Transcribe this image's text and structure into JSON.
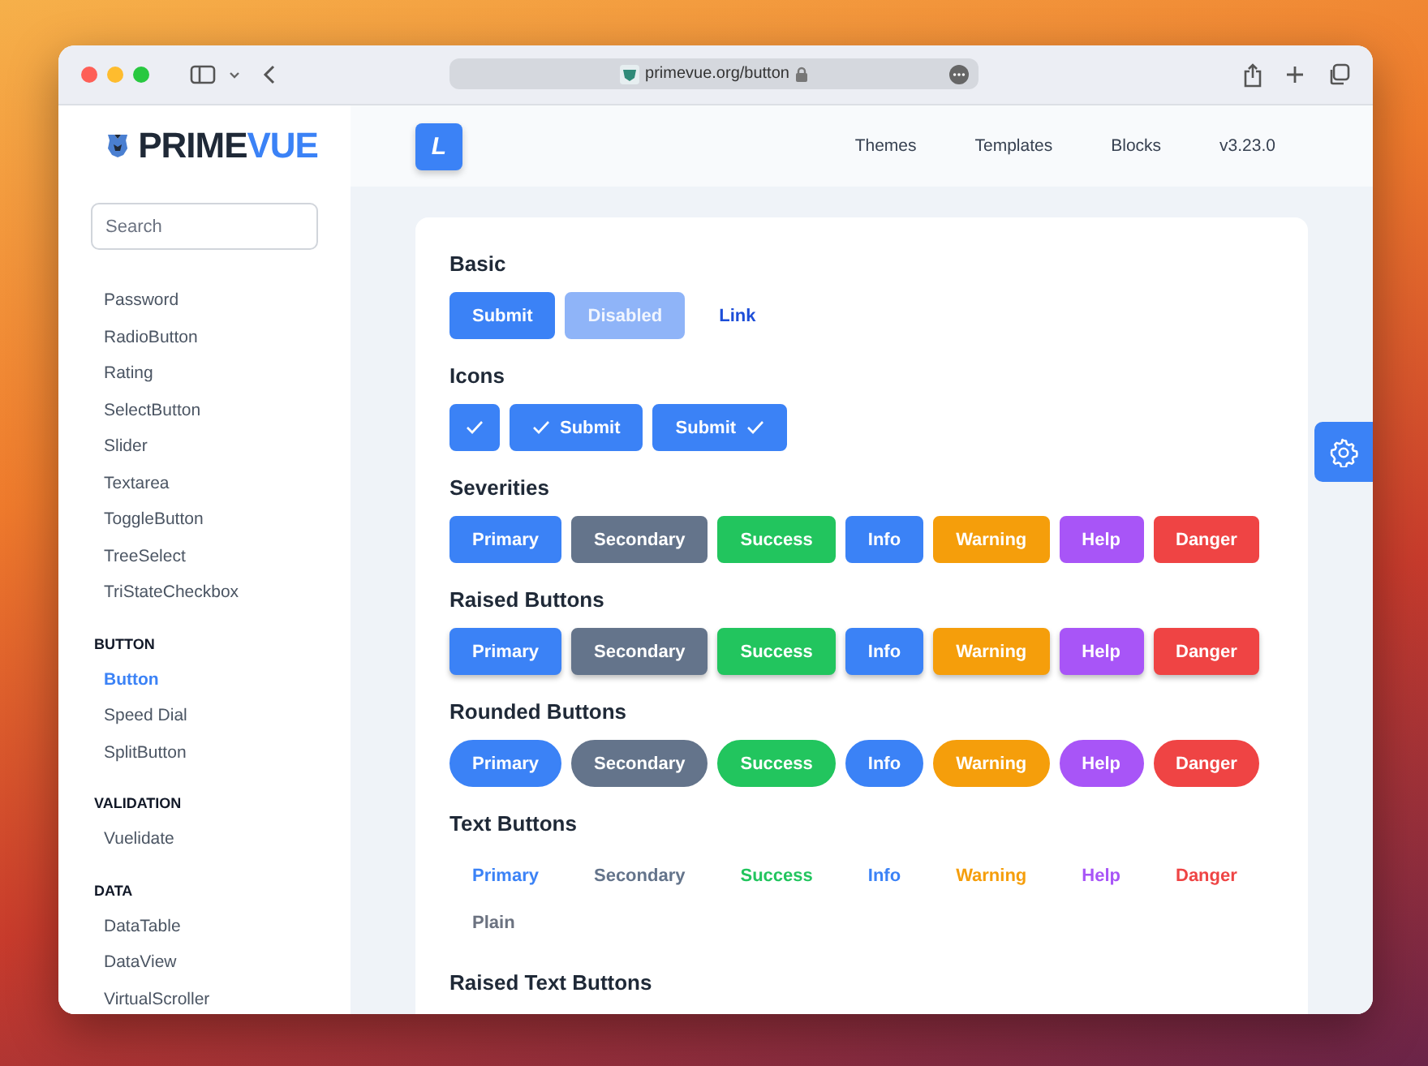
{
  "browser": {
    "url": "primevue.org/button"
  },
  "sidebar": {
    "brand": "PRIME",
    "brand_accent": "VUE",
    "search": {
      "placeholder": "Search"
    },
    "groups": [
      {
        "items": [
          {
            "label": "Password",
            "selected": false
          },
          {
            "label": "RadioButton",
            "selected": false
          },
          {
            "label": "Rating",
            "selected": false
          },
          {
            "label": "SelectButton",
            "selected": false
          },
          {
            "label": "Slider",
            "selected": false
          },
          {
            "label": "Textarea",
            "selected": false
          },
          {
            "label": "ToggleButton",
            "selected": false
          },
          {
            "label": "TreeSelect",
            "selected": false
          },
          {
            "label": "TriStateCheckbox",
            "selected": false
          }
        ]
      },
      {
        "header": "BUTTON",
        "items": [
          {
            "label": "Button",
            "selected": true
          },
          {
            "label": "Speed Dial",
            "selected": false
          },
          {
            "label": "SplitButton",
            "selected": false
          }
        ]
      },
      {
        "header": "VALIDATION",
        "items": [
          {
            "label": "Vuelidate",
            "selected": false
          }
        ]
      },
      {
        "header": "DATA",
        "items": [
          {
            "label": "DataTable",
            "selected": false
          },
          {
            "label": "DataView",
            "selected": false
          },
          {
            "label": "VirtualScroller",
            "selected": false
          }
        ]
      }
    ]
  },
  "topbar": {
    "badge": "L",
    "nav": [
      "Themes",
      "Templates",
      "Blocks",
      "v3.23.0"
    ]
  },
  "sections": [
    {
      "title": "Basic",
      "kind": "filled",
      "rows": [
        [
          {
            "kind": "text-only",
            "label": "Submit",
            "color": "#3b82f6",
            "disabled": false
          },
          {
            "kind": "text-only",
            "label": "Disabled",
            "color": "#8fb4f8",
            "disabled": true
          },
          {
            "kind": "link",
            "label": "Link",
            "color": "#1d4ed8",
            "disabled": false
          }
        ]
      ]
    },
    {
      "title": "Icons",
      "kind": "filled",
      "rows": [
        [
          {
            "kind": "icon-only",
            "color": "#3b82f6",
            "disabled": false
          },
          {
            "kind": "icon-left",
            "label": "Submit",
            "color": "#3b82f6",
            "disabled": false
          },
          {
            "kind": "icon-right",
            "label": "Submit",
            "color": "#3b82f6",
            "disabled": false
          }
        ]
      ]
    },
    {
      "title": "Severities",
      "kind": "filled",
      "rows": [
        [
          {
            "kind": "text-only",
            "label": "Primary",
            "color": "#3b82f6",
            "disabled": false
          },
          {
            "kind": "text-only",
            "label": "Secondary",
            "color": "#64748b",
            "disabled": false
          },
          {
            "kind": "text-only",
            "label": "Success",
            "color": "#22c55e",
            "disabled": false
          },
          {
            "kind": "text-only",
            "label": "Info",
            "color": "#3b82f6",
            "disabled": false
          },
          {
            "kind": "text-only",
            "label": "Warning",
            "color": "#f59e0b",
            "disabled": false
          },
          {
            "kind": "text-only",
            "label": "Help",
            "color": "#a855f7",
            "disabled": false
          },
          {
            "kind": "text-only",
            "label": "Danger",
            "color": "#ef4444",
            "disabled": false
          }
        ]
      ]
    },
    {
      "title": "Raised Buttons",
      "kind": "raised",
      "rows": [
        [
          {
            "kind": "text-only",
            "label": "Primary",
            "color": "#3b82f6",
            "disabled": false
          },
          {
            "kind": "text-only",
            "label": "Secondary",
            "color": "#64748b",
            "disabled": false
          },
          {
            "kind": "text-only",
            "label": "Success",
            "color": "#22c55e",
            "disabled": false
          },
          {
            "kind": "text-only",
            "label": "Info",
            "color": "#3b82f6",
            "disabled": false
          },
          {
            "kind": "text-only",
            "label": "Warning",
            "color": "#f59e0b",
            "disabled": false
          },
          {
            "kind": "text-only",
            "label": "Help",
            "color": "#a855f7",
            "disabled": false
          },
          {
            "kind": "text-only",
            "label": "Danger",
            "color": "#ef4444",
            "disabled": false
          }
        ]
      ]
    },
    {
      "title": "Rounded Buttons",
      "kind": "rounded",
      "rows": [
        [
          {
            "kind": "text-only",
            "label": "Primary",
            "color": "#3b82f6",
            "disabled": false
          },
          {
            "kind": "text-only",
            "label": "Secondary",
            "color": "#64748b",
            "disabled": false
          },
          {
            "kind": "text-only",
            "label": "Success",
            "color": "#22c55e",
            "disabled": false
          },
          {
            "kind": "text-only",
            "label": "Info",
            "color": "#3b82f6",
            "disabled": false
          },
          {
            "kind": "text-only",
            "label": "Warning",
            "color": "#f59e0b",
            "disabled": false
          },
          {
            "kind": "text-only",
            "label": "Help",
            "color": "#a855f7",
            "disabled": false
          },
          {
            "kind": "text-only",
            "label": "Danger",
            "color": "#ef4444",
            "disabled": false
          }
        ]
      ]
    },
    {
      "title": "Text Buttons",
      "kind": "text",
      "rows": [
        [
          {
            "kind": "text-only",
            "label": "Primary",
            "color": "#3b82f6",
            "disabled": false
          },
          {
            "kind": "text-only",
            "label": "Secondary",
            "color": "#64748b",
            "disabled": false
          },
          {
            "kind": "text-only",
            "label": "Success",
            "color": "#22c55e",
            "disabled": false
          },
          {
            "kind": "text-only",
            "label": "Info",
            "color": "#3b82f6",
            "disabled": false
          },
          {
            "kind": "text-only",
            "label": "Warning",
            "color": "#f59e0b",
            "disabled": false
          },
          {
            "kind": "text-only",
            "label": "Help",
            "color": "#a855f7",
            "disabled": false
          },
          {
            "kind": "text-only",
            "label": "Danger",
            "color": "#ef4444",
            "disabled": false
          }
        ],
        [
          {
            "kind": "text-only",
            "label": "Plain",
            "color": "#6b7280",
            "disabled": false
          }
        ]
      ]
    },
    {
      "title": "Raised Text Buttons"
    }
  ]
}
